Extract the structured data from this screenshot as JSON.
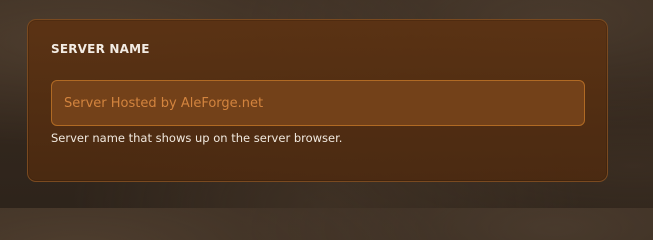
{
  "server_name_section": {
    "title": "SERVER NAME",
    "input": {
      "value": "",
      "placeholder": "Server Hosted by AleForge.net"
    },
    "help_text": "Server name that shows up on the server browser."
  },
  "colors": {
    "panel_background": "#5a3213",
    "panel_border": "#7a4a20",
    "input_background": "#734119",
    "input_border": "#b06a24",
    "placeholder_text": "#d3843e",
    "label_text": "#f3ece4"
  }
}
